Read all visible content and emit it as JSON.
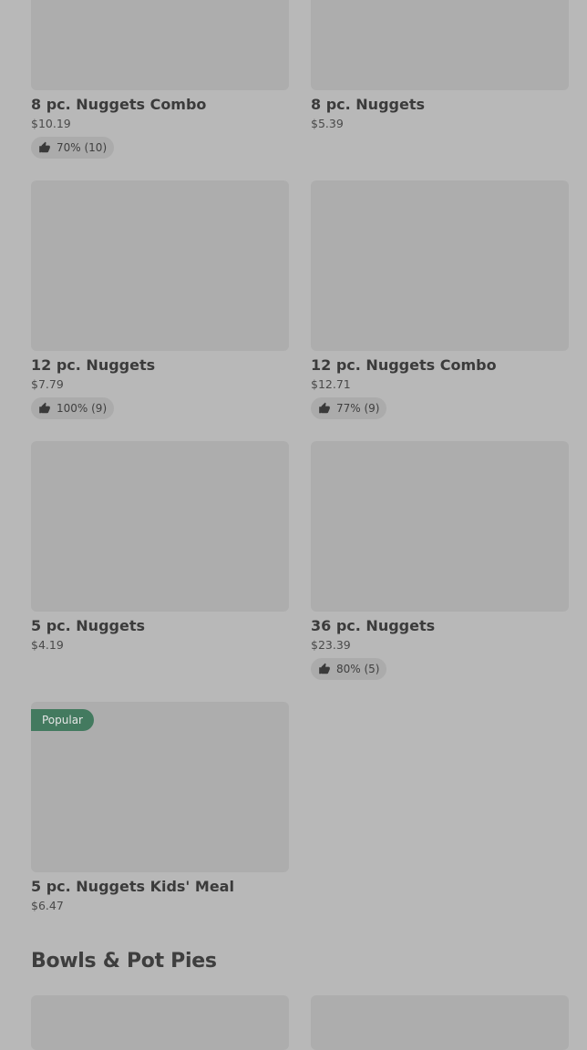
{
  "items": [
    {
      "name": "8 pc. Nuggets Combo",
      "price": "$10.19",
      "rating": "70% (10)",
      "badge": null
    },
    {
      "name": "8 pc. Nuggets",
      "price": "$5.39",
      "rating": null,
      "badge": null
    },
    {
      "name": "12 pc. Nuggets",
      "price": "$7.79",
      "rating": "100% (9)",
      "badge": null
    },
    {
      "name": "12 pc. Nuggets Combo",
      "price": "$12.71",
      "rating": "77% (9)",
      "badge": null
    },
    {
      "name": "5 pc. Nuggets",
      "price": "$4.19",
      "rating": null,
      "badge": null
    },
    {
      "name": "36 pc. Nuggets",
      "price": "$23.39",
      "rating": "80% (5)",
      "badge": null
    },
    {
      "name": "5 pc. Nuggets Kids' Meal",
      "price": "$6.47",
      "rating": null,
      "badge": "Popular"
    }
  ],
  "section": {
    "title": "Bowls & Pot Pies"
  },
  "icons": {
    "rating": "thumbs-up-icon"
  },
  "colors": {
    "background": "#b8b8b8",
    "thumbnail": "#adadad",
    "popular_badge": "#437a5f"
  }
}
